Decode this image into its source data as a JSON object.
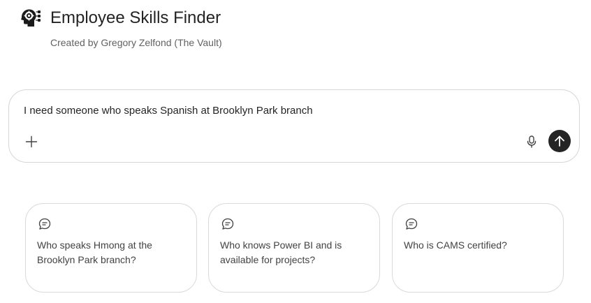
{
  "header": {
    "logo_icon": "head-gear-icon",
    "title": "Employee Skills Finder",
    "subtitle": "Created by Gregory Zelfond (The Vault)"
  },
  "composer": {
    "value": "I need someone who speaks Spanish at Brooklyn Park branch",
    "add_icon": "plus-icon",
    "mic_icon": "microphone-icon",
    "send_icon": "arrow-up-icon"
  },
  "suggestions": [
    {
      "icon": "chat-bubble-icon",
      "text": "Who speaks Hmong at the Brooklyn Park branch?"
    },
    {
      "icon": "chat-bubble-icon",
      "text": "Who knows Power BI and is available for projects?"
    },
    {
      "icon": "chat-bubble-icon",
      "text": "Who is CAMS certified?"
    }
  ],
  "colors": {
    "text": "#242424",
    "muted": "#616161",
    "border": "#d6d6d6",
    "send_button": "#242424"
  }
}
